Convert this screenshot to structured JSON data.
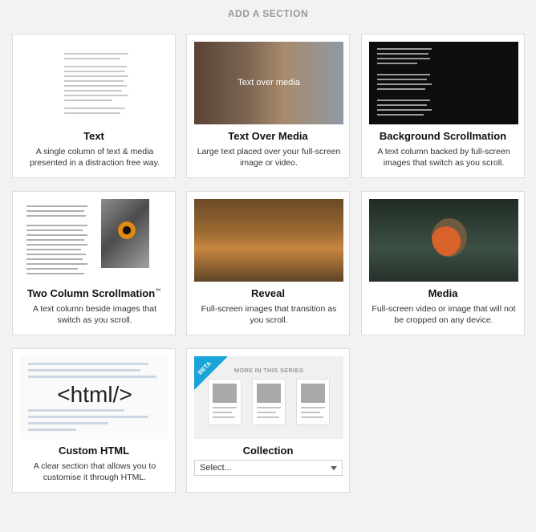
{
  "header": {
    "title": "ADD A SECTION"
  },
  "sections": [
    {
      "title": "Text",
      "description": "A single column of text & media presented in a distraction free way."
    },
    {
      "title": "Text Over Media",
      "description": "Large text placed over your full-screen image or video.",
      "overlay": "Text over media"
    },
    {
      "title": "Background Scrollmation",
      "description": "A text column backed by full-screen images that switch as you scroll."
    },
    {
      "title": "Two Column Scrollmation",
      "trademark": "™",
      "description": "A text column beside images that switch as you scroll."
    },
    {
      "title": "Reveal",
      "description": "Full-screen images that transition as you scroll."
    },
    {
      "title": "Media",
      "description": "Full-screen video or image that will not be cropped on any device."
    },
    {
      "title": "Custom HTML",
      "description": "A clear section that allows you to customise it through HTML.",
      "thumb_label": "<html/>"
    },
    {
      "title": "Collection",
      "badge": "BETA",
      "thumb_label": "MORE IN THIS SERIES",
      "select": {
        "value": "Select..."
      }
    }
  ]
}
